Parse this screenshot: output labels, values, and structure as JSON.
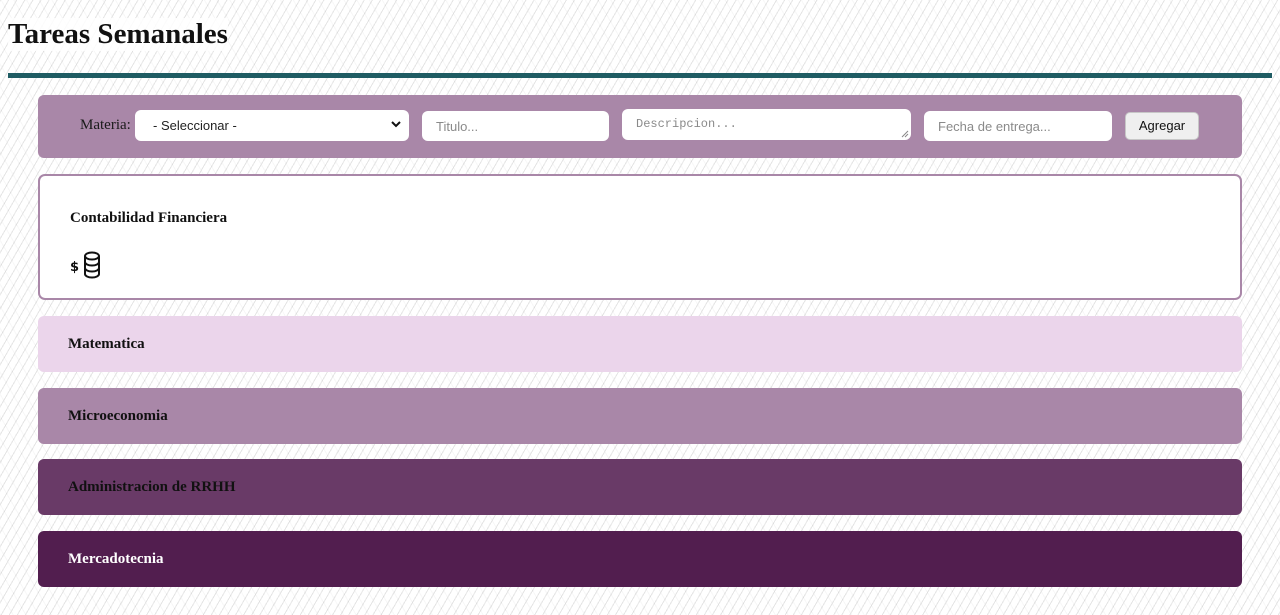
{
  "header": {
    "title": "Tareas Semanales"
  },
  "form": {
    "subject_label": "Materia:",
    "subject_select_value": "- Seleccionar -",
    "title_placeholder": "Titulo...",
    "description_placeholder": "Descripcion...",
    "due_date_placeholder": "Fecha de entrega...",
    "add_label": "Agregar"
  },
  "subjects": [
    {
      "name": "Contabilidad Financiera",
      "expanded": true,
      "icon": "coins-dollar-icon"
    },
    {
      "name": "Matematica",
      "color": "#ebd5eb"
    },
    {
      "name": "Microeconomia",
      "color": "#a987a8"
    },
    {
      "name": "Administracion de RRHH",
      "color": "#693a67"
    },
    {
      "name": "Mercadotecnia",
      "color": "#521e4f"
    }
  ],
  "colors": {
    "accent_bar": "#1f5c63",
    "form_bar": "#a987a8"
  }
}
